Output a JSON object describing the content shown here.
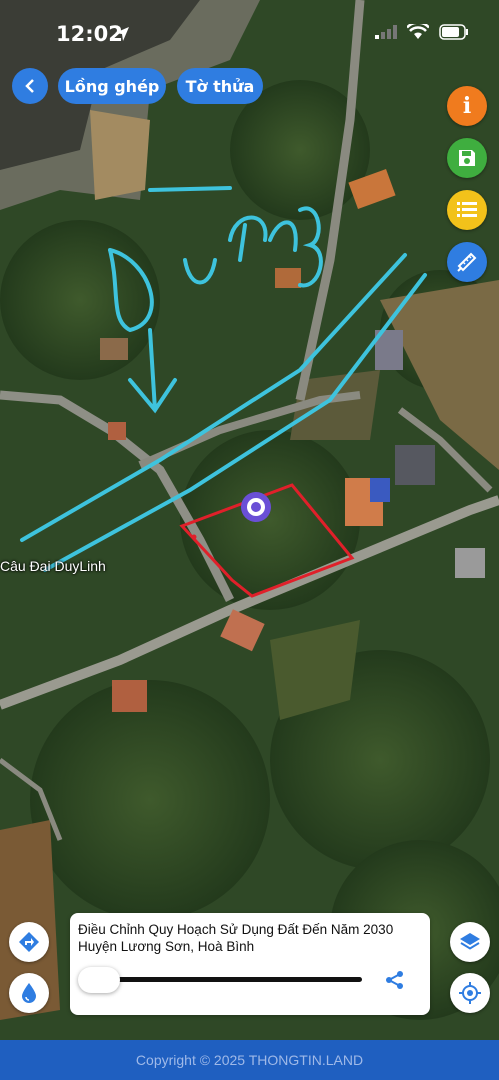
{
  "status_bar": {
    "time": "12:02"
  },
  "top_nav": {
    "back_label": "<",
    "tab_1": "Lồng ghép",
    "tab_2": "Tờ thửa"
  },
  "side_tools": [
    {
      "name": "info-icon",
      "color": "#f07b1e"
    },
    {
      "name": "save-icon",
      "color": "#3fae3f"
    },
    {
      "name": "list-icon",
      "color": "#f2c21a"
    },
    {
      "name": "edit-ruler-icon",
      "color": "#2f7de1"
    }
  ],
  "map": {
    "place_label": "Câu Đai DuyLinh",
    "annotation_text": "Đường",
    "annotation_color": "#3ec3dd",
    "parcel_outline_color": "#e0202a",
    "marker_color": "#6a4fd6"
  },
  "info_card": {
    "title": "Điều Chỉnh Quy Hoạch Sử Dụng Đất Đến Năm 2030 Huyện Lương Sơn, Hoà Bình",
    "opacity": 0.1
  },
  "left_tools": [
    {
      "name": "directions-icon"
    },
    {
      "name": "water-drop-icon"
    }
  ],
  "right_tools": [
    {
      "name": "layers-icon"
    },
    {
      "name": "my-location-icon"
    }
  ],
  "footer": {
    "copyright": "Copyright © 2025 THONGTIN.LAND"
  },
  "colors": {
    "accent": "#2f7de1",
    "footer_bg": "#1f5fc0"
  }
}
